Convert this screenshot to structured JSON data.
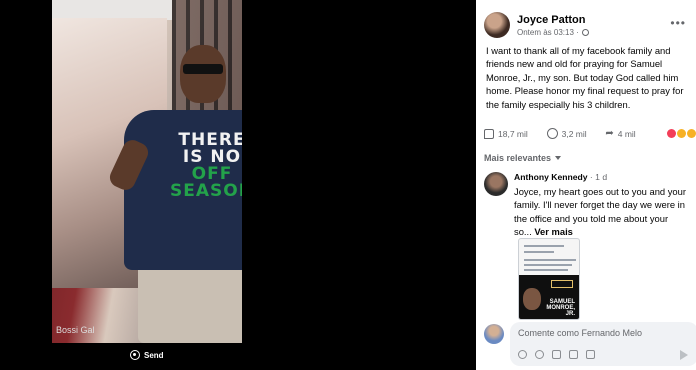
{
  "photo": {
    "shirt_line1": "THERE",
    "shirt_line2": "IS NO",
    "shirt_line3": "OFF",
    "shirt_line4": "SEASON",
    "credit": "Bossi Gal"
  },
  "viewer": {
    "send_label": "Send"
  },
  "post": {
    "author": "Joyce Patton",
    "time": "Ontem às 03:13 ·",
    "text": "I want to thank all of my facebook family and friends new and old for praying for Samuel Monroe, Jr., my son. But today God called him home. Please honor my final request to pray for the family especially his 3 children.",
    "more_icon": "•••"
  },
  "stats": {
    "likes": "18,7 mil",
    "comments": "3,2 mil",
    "shares": "4 mil"
  },
  "comments_sort": "Mais relevantes",
  "comment": {
    "name": "Anthony Kennedy",
    "time": " · 1 d",
    "text": "Joyce, my heart goes out to you and your family. I'll never forget the day we were in the office and you told me about your so...",
    "see_more": " Ver mais",
    "thumb_name": "SAMUEL MONROE, JR."
  },
  "composer": {
    "placeholder": "Comente como Fernando Melo"
  },
  "colors": {
    "accent": "#1877f2",
    "muted": "#65676b",
    "shirt_green": "#23a24a"
  }
}
